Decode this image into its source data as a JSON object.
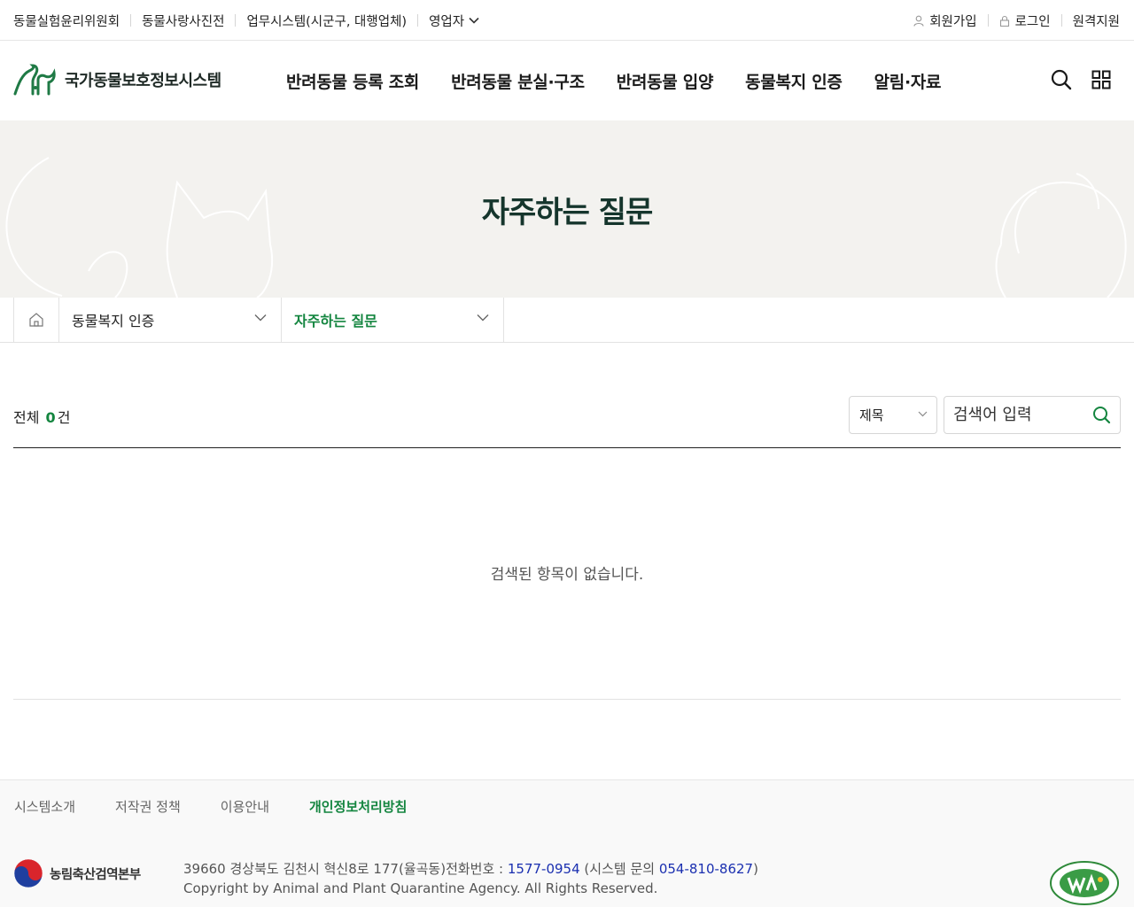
{
  "util": {
    "left": [
      "동물실험윤리위원회",
      "동물사랑사진전",
      "업무시스템(시군구, 대행업체)",
      "영업자"
    ],
    "right": [
      "회원가입",
      "로그인",
      "원격지원"
    ]
  },
  "header": {
    "logo_text": "국가동물보호정보시스템",
    "gnb": [
      "반려동물 등록 조회",
      "반려동물 분실·구조",
      "반려동물 입양",
      "동물복지 인증",
      "알림·자료"
    ]
  },
  "visual": {
    "title": "자주하는 질문"
  },
  "location": {
    "depth1": "동물복지 인증",
    "depth2": "자주하는 질문"
  },
  "board": {
    "total_prefix": "전체",
    "total_count": "0",
    "total_suffix": "건",
    "search_select": "제목",
    "search_placeholder": "검색어 입력",
    "empty_message": "검색된 항목이 없습니다."
  },
  "footer": {
    "nav": [
      "시스템소개",
      "저작권 정책",
      "이용안내",
      "개인정보처리방침"
    ],
    "org_name": "농림축산검역본부",
    "address": "39660 경상북도 김천시 혁신8로 177(율곡동)전화번호 :",
    "tel": "1577-0954",
    "sys_prefix": "(시스템 문의",
    "sys_tel": "054-810-8627",
    "sys_suffix": ")",
    "copyright": "Copyright by Animal and Plant Quarantine Agency. All Rights Reserved."
  },
  "colors": {
    "accent_green": "#13853f",
    "title_dark": "#15352c",
    "link_blue": "#1a2fb0"
  }
}
